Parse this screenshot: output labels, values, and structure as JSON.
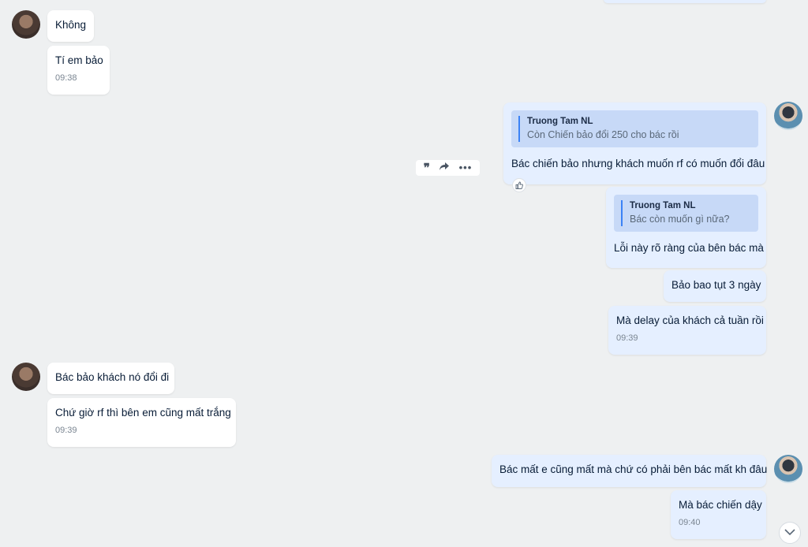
{
  "messages": {
    "m1": {
      "text": "Không"
    },
    "m2": {
      "text": "Tí em bảo",
      "time": "09:38"
    },
    "m3": {
      "quote_name": "Truong Tam NL",
      "quote_text": "Còn Chiến bảo đổi 250 cho bác rồi",
      "text": "Bác chiến bảo nhưng khách muốn rf có muốn đổi đâu"
    },
    "m4": {
      "quote_name": "Truong Tam NL",
      "quote_text": "Bác còn muốn gì nữa?",
      "text": "Lỗi này rõ ràng của bên bác mà"
    },
    "m5": {
      "text": "Bảo bao tụt 3 ngày"
    },
    "m6": {
      "text": "Mà delay của khách cả tuần rồi",
      "time": "09:39"
    },
    "m7": {
      "text": "Bác bảo khách nó đổi đi"
    },
    "m8": {
      "text": "Chứ giờ rf thì bên em cũng mất trắng",
      "time": "09:39"
    },
    "m9": {
      "text": "Bác mất e cũng mất mà chứ có phải bên bác mất kh đâu"
    },
    "m10": {
      "text": "Mà bác chiến dậy",
      "time": "09:40"
    }
  },
  "toolbar": {
    "quote_icon": "quote-icon",
    "forward_icon": "share-icon",
    "more_icon": "more-icon"
  },
  "colors": {
    "incoming_bg": "#ffffff",
    "outgoing_bg": "#e5efff",
    "quote_bar": "#3b82f6"
  }
}
